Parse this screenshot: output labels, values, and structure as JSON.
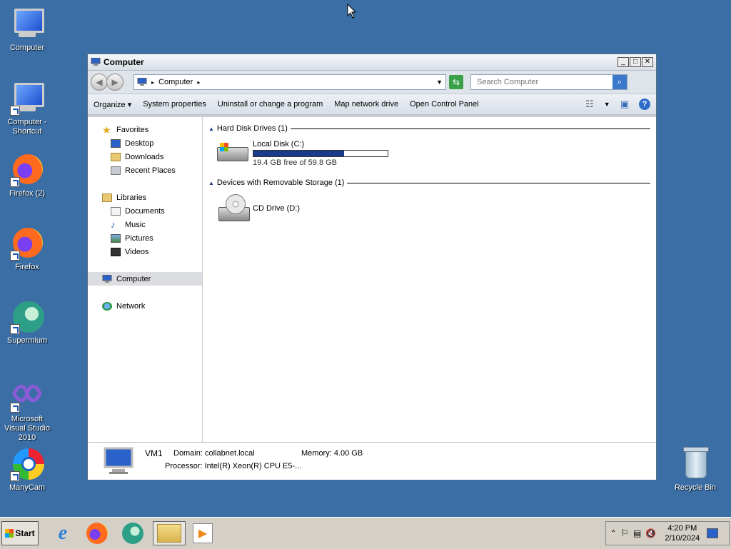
{
  "desktop": {
    "icons": [
      {
        "label": "Computer"
      },
      {
        "label": "Computer -\nShortcut"
      },
      {
        "label": "Firefox (2)"
      },
      {
        "label": "Firefox"
      },
      {
        "label": "Supermium"
      },
      {
        "label": "Microsoft Visual Studio 2010"
      },
      {
        "label": "ManyCam"
      },
      {
        "label": "Recycle Bin"
      }
    ]
  },
  "window": {
    "title": "Computer",
    "address": {
      "crumb": "Computer"
    },
    "search": {
      "placeholder": "Search Computer"
    },
    "commands": [
      "Organize",
      "System properties",
      "Uninstall or change a program",
      "Map network drive",
      "Open Control Panel"
    ],
    "nav": {
      "favorites": {
        "label": "Favorites",
        "items": [
          "Desktop",
          "Downloads",
          "Recent Places"
        ]
      },
      "libraries": {
        "label": "Libraries",
        "items": [
          "Documents",
          "Music",
          "Pictures",
          "Videos"
        ]
      },
      "computer": "Computer",
      "network": "Network"
    },
    "groups": {
      "hdd": {
        "label": "Hard Disk Drives (1)"
      },
      "removable": {
        "label": "Devices with Removable Storage (1)"
      }
    },
    "drives": {
      "c": {
        "name": "Local Disk (C:)",
        "free_text": "19.4 GB free of 59.8 GB",
        "used_fraction": 0.676
      },
      "d": {
        "name": "CD Drive (D:)"
      }
    },
    "details": {
      "name": "VM1",
      "domain": "Domain: collabnet.local",
      "memory": "Memory: 4.00 GB",
      "processor": "Processor: Intel(R) Xeon(R) CPU E5-..."
    }
  },
  "taskbar": {
    "start": "Start",
    "time": "4:20 PM",
    "date": "2/10/2024"
  },
  "colors": {
    "desktop": "#3a6ea5",
    "capacity_fill": "#1a3a8c"
  }
}
